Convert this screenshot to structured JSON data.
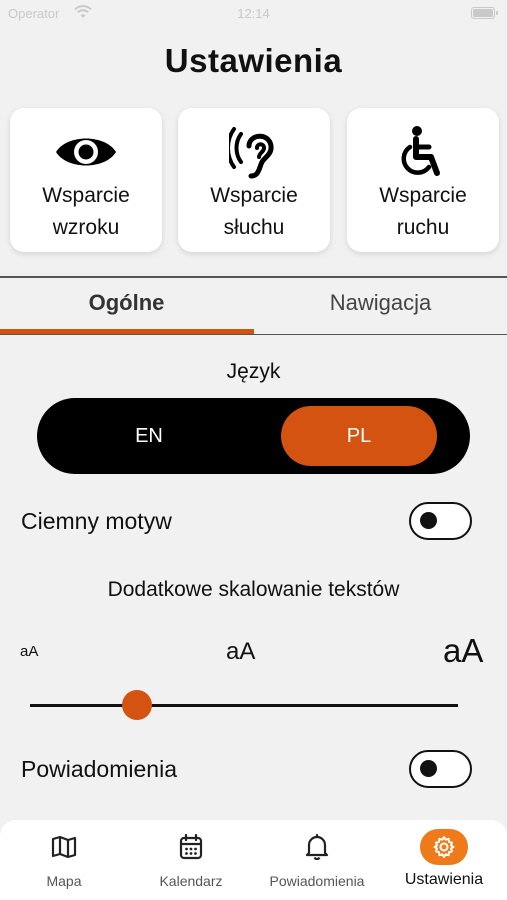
{
  "status": {
    "carrier": "Operator",
    "time": "12:14"
  },
  "title": "Ustawienia",
  "support_cards": [
    {
      "label": "Wsparcie\nwzroku",
      "icon": "eye-icon"
    },
    {
      "label": "Wsparcie\nsłuchu",
      "icon": "ear-icon"
    },
    {
      "label": "Wsparcie\nruchu",
      "icon": "wheelchair-icon"
    }
  ],
  "tabs": [
    {
      "label": "Ogólne",
      "active": true
    },
    {
      "label": "Nawigacja",
      "active": false
    }
  ],
  "language": {
    "label": "Język",
    "options": [
      "EN",
      "PL"
    ],
    "selected": "PL"
  },
  "dark_theme": {
    "label": "Ciemny motyw",
    "enabled": false
  },
  "text_scaling": {
    "label": "Dodatkowe skalowanie tekstów",
    "samples": [
      "aA",
      "aA",
      "aA"
    ],
    "value": 0.25
  },
  "notifications": {
    "label": "Powiadomienia",
    "enabled": false
  },
  "accent_color": "#d45311",
  "bottom_nav": [
    {
      "label": "Mapa",
      "icon": "map-icon",
      "active": false
    },
    {
      "label": "Kalendarz",
      "icon": "calendar-icon",
      "active": false
    },
    {
      "label": "Powiadomienia",
      "icon": "bell-icon",
      "active": false
    },
    {
      "label": "Ustawienia",
      "icon": "gear-icon",
      "active": true
    }
  ]
}
